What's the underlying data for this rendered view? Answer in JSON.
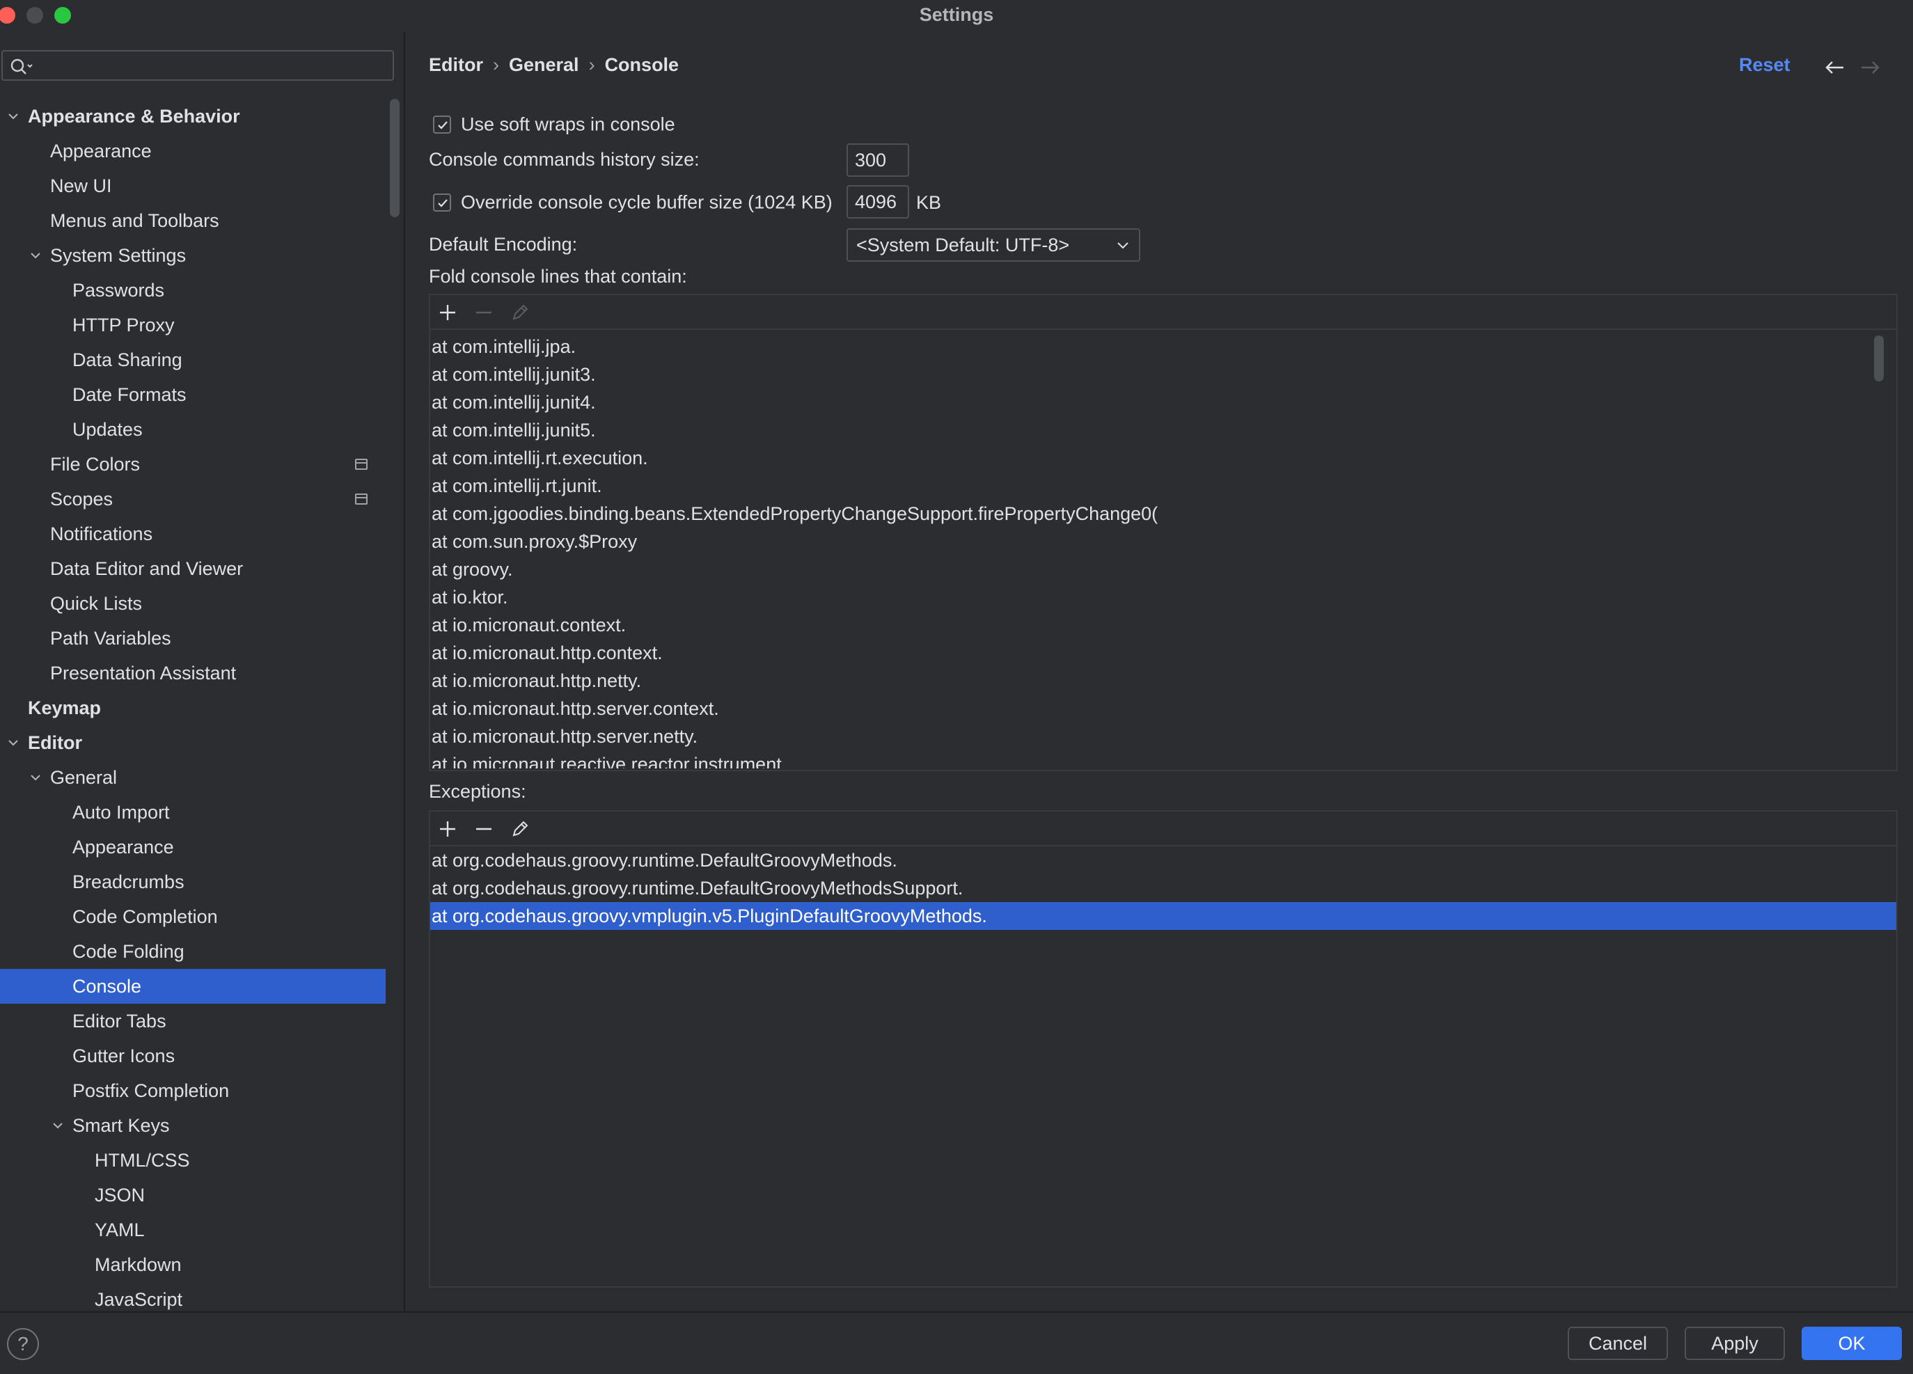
{
  "window": {
    "title": "Settings"
  },
  "search": {
    "placeholder": ""
  },
  "sidebar": {
    "items": [
      {
        "label": "Appearance & Behavior",
        "bold": true,
        "expanded": true
      },
      {
        "label": "Appearance"
      },
      {
        "label": "New UI"
      },
      {
        "label": "Menus and Toolbars"
      },
      {
        "label": "System Settings",
        "expanded": true
      },
      {
        "label": "Passwords"
      },
      {
        "label": "HTTP Proxy"
      },
      {
        "label": "Data Sharing"
      },
      {
        "label": "Date Formats"
      },
      {
        "label": "Updates"
      },
      {
        "label": "File Colors",
        "icon": "project-icon"
      },
      {
        "label": "Scopes",
        "icon": "project-icon"
      },
      {
        "label": "Notifications"
      },
      {
        "label": "Data Editor and Viewer"
      },
      {
        "label": "Quick Lists"
      },
      {
        "label": "Path Variables"
      },
      {
        "label": "Presentation Assistant"
      },
      {
        "label": "Keymap",
        "bold": true
      },
      {
        "label": "Editor",
        "bold": true,
        "expanded": true
      },
      {
        "label": "General",
        "expanded": true
      },
      {
        "label": "Auto Import"
      },
      {
        "label": "Appearance"
      },
      {
        "label": "Breadcrumbs"
      },
      {
        "label": "Code Completion"
      },
      {
        "label": "Code Folding"
      },
      {
        "label": "Console",
        "selected": true
      },
      {
        "label": "Editor Tabs"
      },
      {
        "label": "Gutter Icons"
      },
      {
        "label": "Postfix Completion"
      },
      {
        "label": "Smart Keys",
        "expanded": true
      },
      {
        "label": "HTML/CSS"
      },
      {
        "label": "JSON"
      },
      {
        "label": "YAML"
      },
      {
        "label": "Markdown"
      },
      {
        "label": "JavaScript"
      }
    ]
  },
  "breadcrumb": {
    "part1": "Editor",
    "part2": "General",
    "part3": "Console",
    "separator": "›"
  },
  "header": {
    "reset": "Reset"
  },
  "settings": {
    "soft_wraps_label": "Use soft wraps in console",
    "soft_wraps_checked": true,
    "history_label": "Console commands history size:",
    "history_value": "300",
    "override_label": "Override console cycle buffer size (1024 KB)",
    "override_checked": true,
    "override_value": "4096",
    "override_unit": "KB",
    "encoding_label": "Default Encoding:",
    "encoding_value": "<System Default: UTF-8>",
    "fold_label": "Fold console lines that contain:",
    "exceptions_label": "Exceptions:"
  },
  "fold_lines": [
    "at com.intellij.jpa.",
    "at com.intellij.junit3.",
    "at com.intellij.junit4.",
    "at com.intellij.junit5.",
    "at com.intellij.rt.execution.",
    "at com.intellij.rt.junit.",
    "at com.jgoodies.binding.beans.ExtendedPropertyChangeSupport.firePropertyChange0(",
    "at com.sun.proxy.$Proxy",
    "at groovy.",
    "at io.ktor.",
    "at io.micronaut.context.",
    "at io.micronaut.http.context.",
    "at io.micronaut.http.netty.",
    "at io.micronaut.http.server.context.",
    "at io.micronaut.http.server.netty.",
    "at io.micronaut.reactive.reactor.instrument."
  ],
  "exception_lines": [
    "at org.codehaus.groovy.runtime.DefaultGroovyMethods.",
    "at org.codehaus.groovy.runtime.DefaultGroovyMethodsSupport.",
    "at org.codehaus.groovy.vmplugin.v5.PluginDefaultGroovyMethods."
  ],
  "exception_selected_index": 2,
  "footer": {
    "help": "?",
    "cancel": "Cancel",
    "apply": "Apply",
    "ok": "OK"
  },
  "colors": {
    "accent": "#2e5fcc",
    "link": "#548af7",
    "background": "#2b2d30",
    "primary_button": "#3574f0"
  }
}
